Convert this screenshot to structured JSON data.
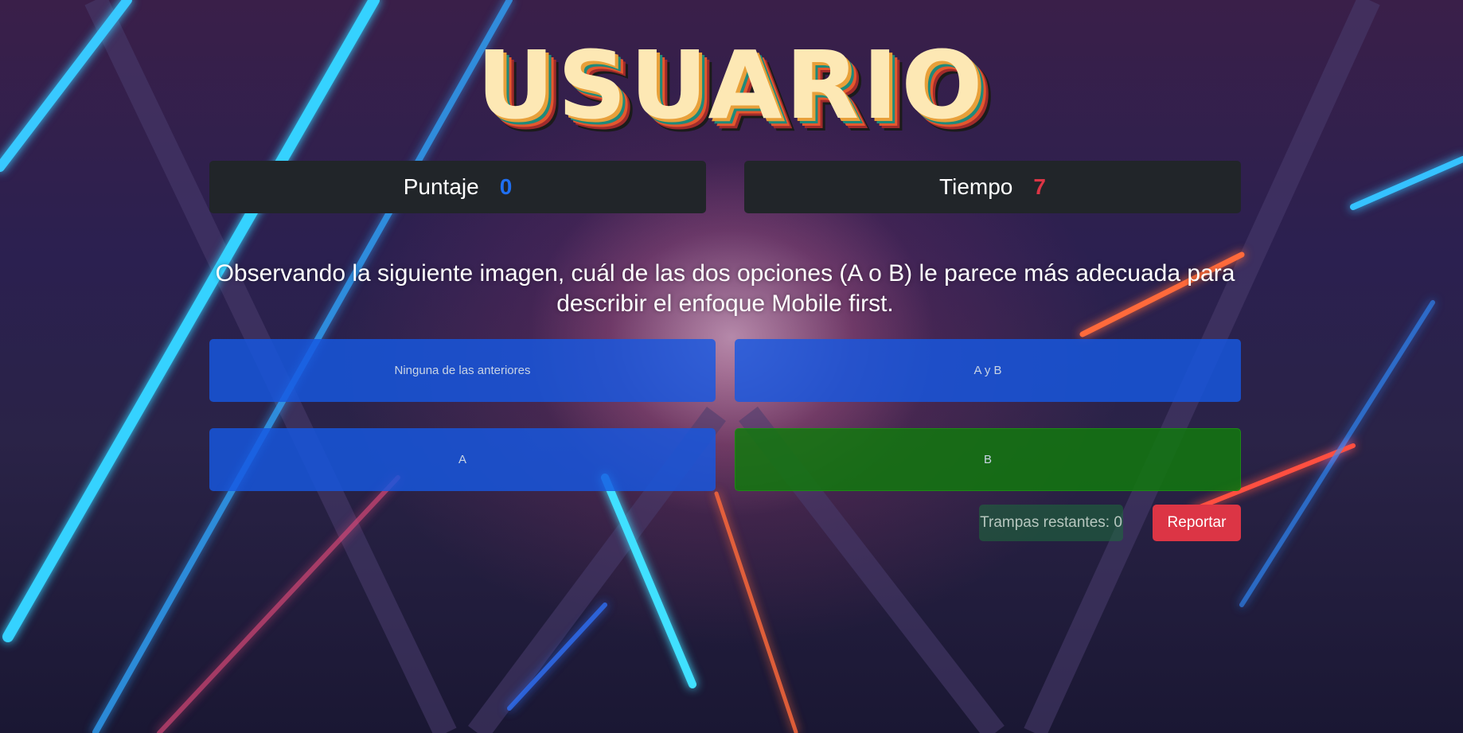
{
  "header": {
    "title": "USUARIO"
  },
  "stats": {
    "score_label": "Puntaje",
    "score_value": "0",
    "time_label": "Tiempo",
    "time_value": "7"
  },
  "question": {
    "text": "Observando la siguiente imagen, cuál de las dos opciones (A o B) le parece más adecuada para describir el enfoque Mobile first."
  },
  "options": [
    {
      "label": "Ninguna de las anteriores",
      "state": "default"
    },
    {
      "label": "A y B",
      "state": "default"
    },
    {
      "label": "A",
      "state": "default"
    },
    {
      "label": "B",
      "state": "correct"
    }
  ],
  "footer": {
    "cheats_label": "Trampas restantes: 0",
    "report_label": "Reportar"
  },
  "colors": {
    "score": "#1f6ff2",
    "time": "#dc3545",
    "option_blue": "#1658e2",
    "option_correct": "#12780e",
    "report": "#dc3545",
    "stat_bg": "#212529"
  }
}
